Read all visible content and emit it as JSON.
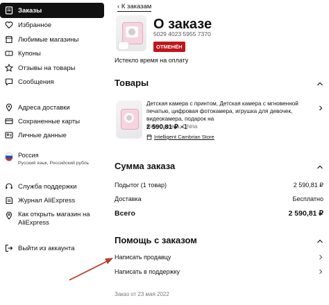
{
  "sidebar": {
    "items": [
      {
        "label": "Заказы",
        "icon": "orders-icon"
      },
      {
        "label": "Избранное",
        "icon": "heart-icon"
      },
      {
        "label": "Любимые магазины",
        "icon": "store-icon"
      },
      {
        "label": "Купоны",
        "icon": "coupon-icon"
      },
      {
        "label": "Отзывы на товары",
        "icon": "star-icon"
      },
      {
        "label": "Сообщения",
        "icon": "message-icon"
      },
      {
        "label": "Адреса доставки",
        "icon": "location-icon"
      },
      {
        "label": "Сохраненные карты",
        "icon": "card-icon"
      },
      {
        "label": "Личные данные",
        "icon": "person-icon"
      },
      {
        "label": "Служба поддержки",
        "icon": "headset-icon"
      },
      {
        "label": "Журнал AliExpress",
        "icon": "journal-icon"
      },
      {
        "label": "Как открыть магазин на",
        "label2": "AliExpress",
        "icon": "pin-icon"
      },
      {
        "label": "Выйти из аккаунта",
        "icon": "logout-icon"
      }
    ],
    "region": {
      "country": "Россия",
      "detail": "Русский язык, Российский рубль"
    }
  },
  "main": {
    "back_link": "К заказам",
    "title": "О заказе",
    "order_number": "5029 4023 5955 7370",
    "status_badge": "ОТМЕНЁН",
    "status_note": "Истекло время на оплату",
    "products_heading": "Товары",
    "product": {
      "description": "Детская камера с принтом, Детская камера с мгновенной печатью, цифровая фотокамера, игрушка для девочек, видеокамера, подарок на",
      "variant": "Kids Camera, China",
      "price": "2 590,81 ₽",
      "qty": "×1",
      "store": "Intelligent Cambrian Store"
    },
    "sum_heading": "Сумма заказа",
    "sum_rows": [
      {
        "label": "Подытог (1 товар)",
        "value": "2 590,81 ₽"
      },
      {
        "label": "Доставка",
        "value": "Бесплатно"
      },
      {
        "label": "Всего",
        "value": "2 590,81 ₽"
      }
    ],
    "help_heading": "Помощь с заказом",
    "help_items": [
      "Написать продавцу",
      "Написать в поддержку"
    ],
    "footer": "Заказ от 23 мая 2022"
  }
}
